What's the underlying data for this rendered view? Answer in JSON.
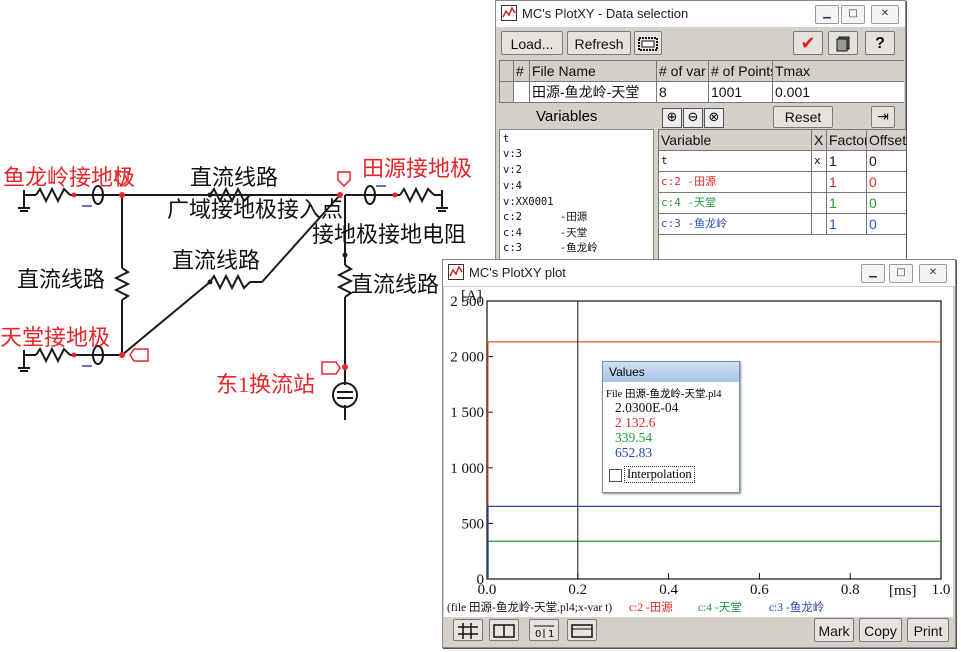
{
  "schematic": {
    "labels": {
      "yulongling": "鱼龙岭接地极",
      "dc_line_top": "直流线路",
      "wide_area": "广域接地极接入点",
      "tianyuan": "田源接地极",
      "ground_resistor": "接地极接地电阻",
      "dc_line_mid": "直流线路",
      "dc_line_left": "直流线路",
      "dc_line_right": "直流线路",
      "tiantang": "天堂接地极",
      "converter": "东1换流站"
    },
    "colors": {
      "red_label": "#e8262a",
      "black_label": "#111111",
      "wire": "#1a1a1a",
      "marker": "#e8262a"
    }
  },
  "data_window": {
    "title": "MC's PlotXY - Data selection",
    "toolbar": {
      "load": "Load...",
      "refresh": "Refresh",
      "help": "?"
    },
    "file_table": {
      "headers": [
        "#",
        "File Name",
        "# of var",
        "# of Points",
        "Tmax"
      ],
      "row": [
        "",
        "田源-鱼龙岭-天堂",
        "8",
        "1001",
        "0.001"
      ]
    },
    "variables_label": "Variables",
    "variables_list": [
      "t",
      "v:3",
      "v:2",
      "v:4",
      "v:XX0001",
      "c:2      -田源",
      "c:4      -天堂",
      "c:3      -鱼龙岭"
    ],
    "reset": "Reset",
    "sel_headers": [
      "Variable",
      "X",
      "Factor",
      "Offset"
    ],
    "sel_rows": [
      {
        "var": "t",
        "x": "x",
        "factor": "1",
        "offset": "0",
        "color": "#111111"
      },
      {
        "var": "c:2      -田源",
        "x": "",
        "factor": "1",
        "offset": "0",
        "color": "#e8262a"
      },
      {
        "var": "c:4      -天堂",
        "x": "",
        "factor": "1",
        "offset": "0",
        "color": "#1f9a3a"
      },
      {
        "var": "c:3      -鱼龙岭",
        "x": "",
        "factor": "1",
        "offset": "0",
        "color": "#2a55b8"
      }
    ]
  },
  "plot_window": {
    "title": "MC's PlotXY plot",
    "y_unit": "[A]",
    "x_unit": "[ms]",
    "y_ticks": [
      "2 500",
      "2 000",
      "1 500",
      "1 000",
      "500",
      "0"
    ],
    "x_ticks": [
      "0.0",
      "0.2",
      "0.4",
      "0.6",
      "0.8",
      "1.0"
    ],
    "values_box": {
      "title": "Values",
      "file": "File 田源-鱼龙岭-天堂.pl4",
      "t": "2.0300E-04",
      "v1": "2 132.6",
      "v2": "339.54",
      "v3": "652.83",
      "interpolation": "Interpolation"
    },
    "legend": {
      "file": "(file 田源-鱼龙岭-天堂.pl4;x-var t)",
      "s1": "c:2  -田源",
      "s2": "c:4  -天堂",
      "s3": "c:3  -鱼龙岭"
    },
    "buttons": {
      "mark": "Mark",
      "copy": "Copy",
      "print": "Print"
    }
  },
  "chart_data": {
    "type": "line",
    "x": [
      0,
      1.0
    ],
    "series": [
      {
        "name": "c:2  -田源",
        "values": [
          2132.6,
          2132.6
        ],
        "color": "#e8562e"
      },
      {
        "name": "c:4  -天堂",
        "values": [
          339.54,
          339.54
        ],
        "color": "#1f9a3a"
      },
      {
        "name": "c:3  -鱼龙岭",
        "values": [
          652.83,
          652.83
        ],
        "color": "#2a45a8"
      }
    ],
    "cursor_x": 0.2,
    "xlim": [
      0,
      1.0
    ],
    "ylim": [
      0,
      2500
    ],
    "xlabel": "[ms]",
    "ylabel": "[A]"
  }
}
